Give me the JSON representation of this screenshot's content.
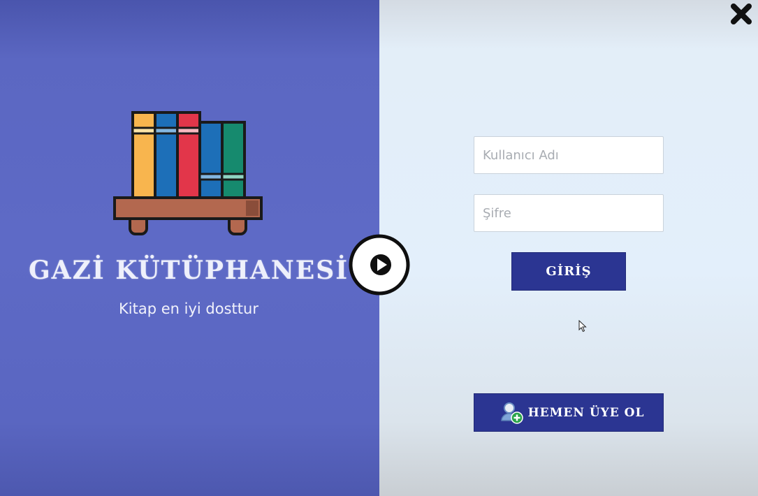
{
  "brand": {
    "title": "GAZİ KÜTÜPHANESİ",
    "tagline": "Kitap en iyi dosttur"
  },
  "icons": {
    "books": "books-on-shelf-icon",
    "play": "play-icon",
    "close": "close-icon",
    "cursor": "mouse-cursor-icon",
    "user_add": "user-add-icon"
  },
  "login_form": {
    "username_placeholder": "Kullanıcı Adı",
    "password_placeholder": "Şifre",
    "login_label": "GİRİŞ"
  },
  "signup": {
    "label": "HEMEN ÜYE OL"
  },
  "colors": {
    "left_panel": "#5e6ac6",
    "right_panel": "#e3effb",
    "button": "#2b3592"
  }
}
